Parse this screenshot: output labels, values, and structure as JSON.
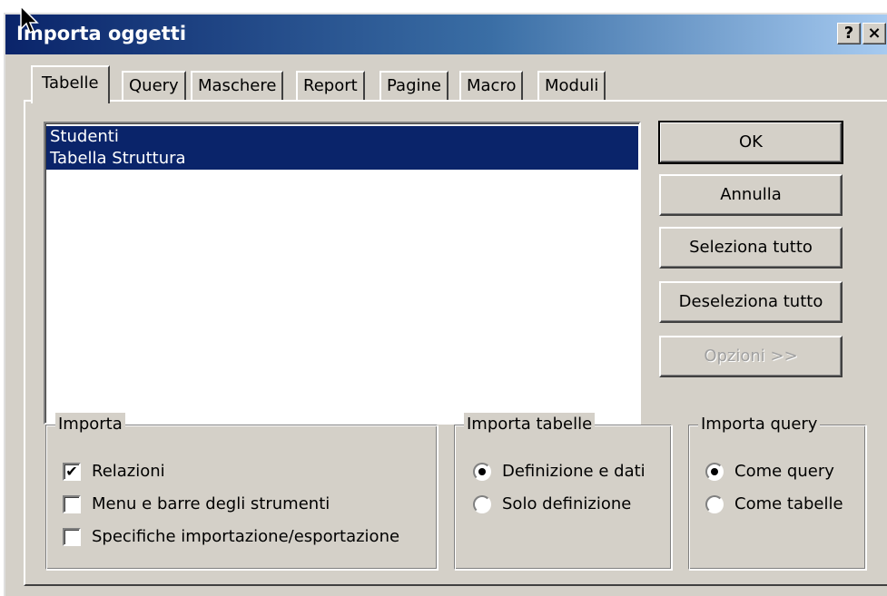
{
  "window": {
    "title": "Importa oggetti",
    "help_label": "?",
    "close_label": "×"
  },
  "tabs": [
    {
      "label": "Tabelle",
      "active": true
    },
    {
      "label": "Query"
    },
    {
      "label": "Maschere"
    },
    {
      "label": "Report"
    },
    {
      "label": "Pagine"
    },
    {
      "label": "Macro"
    },
    {
      "label": "Moduli"
    }
  ],
  "list": {
    "items": [
      "Studenti",
      "Tabella Struttura"
    ],
    "selected_color": "#0a246a"
  },
  "buttons": {
    "ok": "OK",
    "cancel": "Annulla",
    "select_all": "Seleziona tutto",
    "deselect_all": "Deseleziona tutto",
    "options": "Opzioni >>"
  },
  "import_group": {
    "legend": "Importa",
    "options": [
      {
        "label": "Relazioni",
        "checked": true
      },
      {
        "label": "Menu e barre degli strumenti",
        "checked": false
      },
      {
        "label": "Specifiche importazione/esportazione",
        "checked": false
      }
    ]
  },
  "tables_group": {
    "legend": "Importa tabelle",
    "options": [
      {
        "label": "Definizione e dati",
        "selected": true
      },
      {
        "label": "Solo definizione",
        "selected": false
      }
    ]
  },
  "query_group": {
    "legend": "Importa query",
    "options": [
      {
        "label": "Come query",
        "selected": true
      },
      {
        "label": "Come tabelle",
        "selected": false
      }
    ]
  }
}
